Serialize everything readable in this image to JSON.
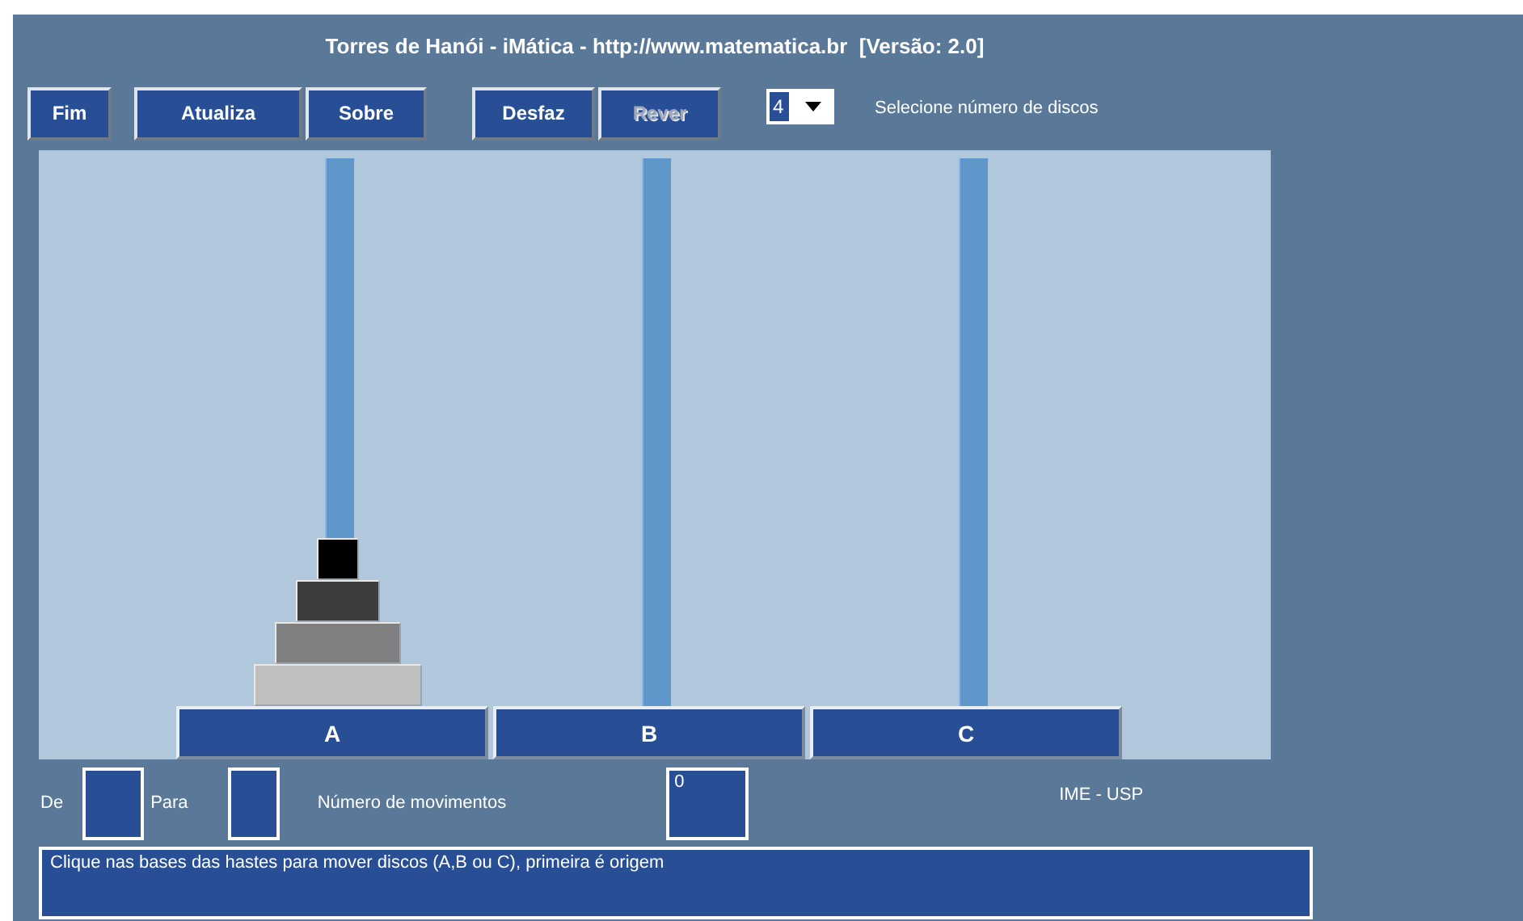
{
  "title": "Torres de Hanói - iMática - http://www.matematica.br  [Versão: 2.0]",
  "buttons": [
    {
      "label": "Fim",
      "disabled": false
    },
    {
      "label": "Atualiza",
      "disabled": false
    },
    {
      "label": "Sobre",
      "disabled": false
    },
    {
      "label": "Desfaz",
      "disabled": false
    },
    {
      "label": "Rever",
      "disabled": true
    }
  ],
  "disk_count": {
    "value": "4",
    "label": "Selecione número de discos"
  },
  "towers": [
    {
      "label": "A",
      "disks": [
        {
          "color": "#c0c0c0"
        },
        {
          "color": "#808080"
        },
        {
          "color": "#3c3c3c"
        },
        {
          "color": "#000000"
        }
      ]
    },
    {
      "label": "B"
    },
    {
      "label": "C"
    }
  ],
  "from_label": "De",
  "to_label": "Para",
  "moves": {
    "label": "Número de movimentos",
    "value": "0"
  },
  "credit": "IME - USP",
  "message": "Clique nas bases das hastes para mover discos (A,B ou C), primeira é origem"
}
